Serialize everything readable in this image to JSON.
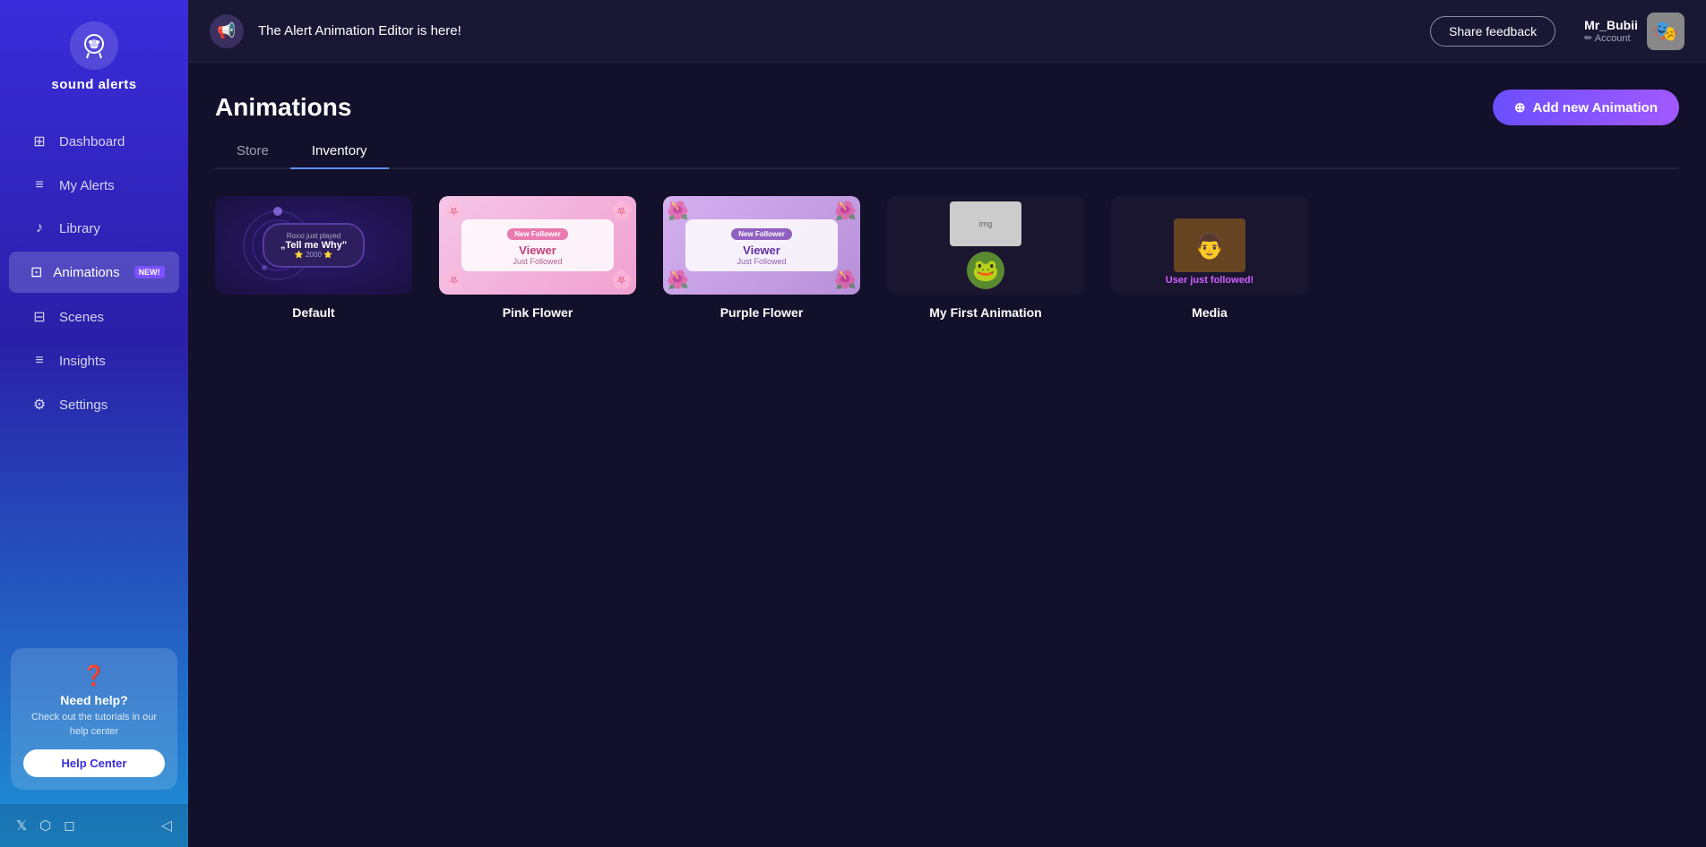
{
  "sidebar": {
    "logo_text": "sound alerts",
    "nav_items": [
      {
        "id": "dashboard",
        "label": "Dashboard",
        "icon": "⊞"
      },
      {
        "id": "my-alerts",
        "label": "My Alerts",
        "icon": "≡"
      },
      {
        "id": "library",
        "label": "Library",
        "icon": "♪"
      },
      {
        "id": "animations",
        "label": "Animations",
        "icon": "⊡",
        "badge": "New!"
      },
      {
        "id": "scenes",
        "label": "Scenes",
        "icon": "⊟"
      },
      {
        "id": "insights",
        "label": "Insights",
        "icon": "≡"
      },
      {
        "id": "settings",
        "label": "Settings",
        "icon": "⚙"
      }
    ],
    "help": {
      "icon": "?",
      "title": "Need help?",
      "description": "Check out the tutorials in our help center",
      "button_label": "Help Center"
    },
    "social": {
      "twitter": "𝕏",
      "discord": "💬",
      "instagram": "📷"
    }
  },
  "topbar": {
    "announcement": "The Alert Animation Editor is here!",
    "share_feedback_label": "Share feedback",
    "user": {
      "name": "Mr_Bubii",
      "account_label": "✏ Account"
    }
  },
  "page": {
    "title": "Animations",
    "add_button_label": "Add new Animation",
    "tabs": [
      {
        "id": "store",
        "label": "Store"
      },
      {
        "id": "inventory",
        "label": "Inventory"
      }
    ],
    "active_tab": "inventory",
    "animations": [
      {
        "id": "default",
        "name": "Default",
        "type": "default"
      },
      {
        "id": "pink-flower",
        "name": "Pink Flower",
        "type": "pink-flower"
      },
      {
        "id": "purple-flower",
        "name": "Purple Flower",
        "type": "purple-flower"
      },
      {
        "id": "my-first-animation",
        "name": "My First Animation",
        "type": "first"
      },
      {
        "id": "media",
        "name": "Media",
        "type": "media"
      }
    ]
  }
}
